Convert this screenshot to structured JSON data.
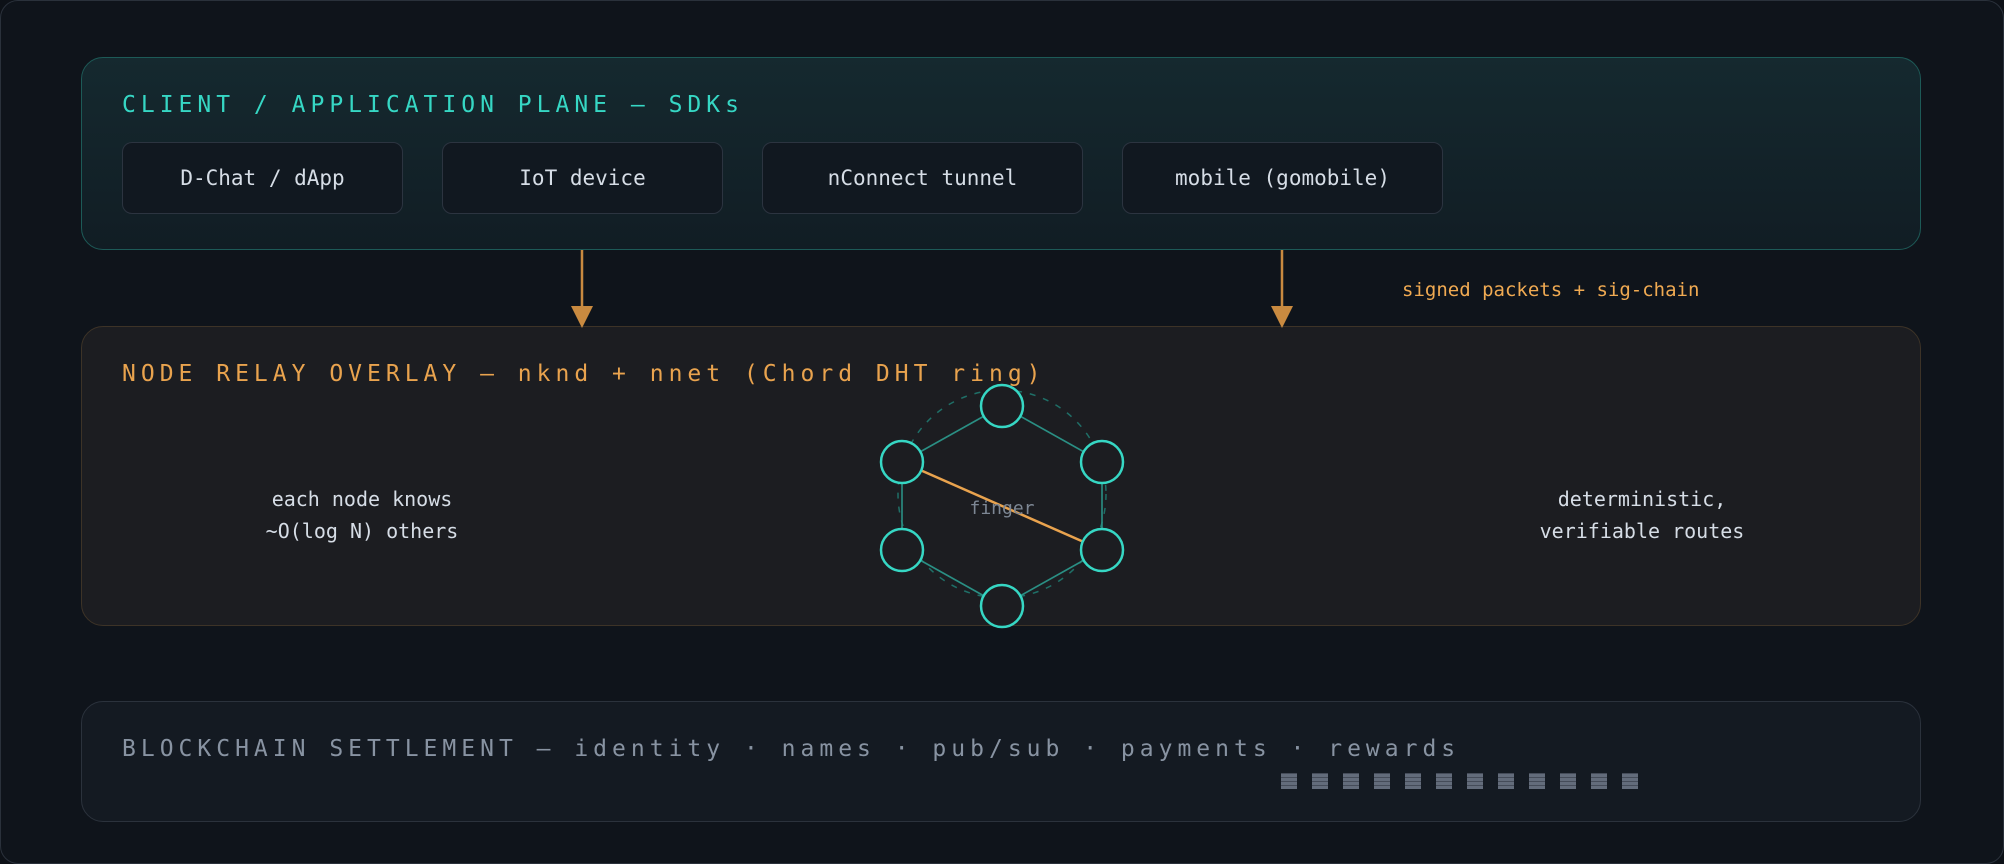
{
  "client_plane": {
    "title": "CLIENT / APPLICATION PLANE — SDKs",
    "items": [
      "D-Chat / dApp",
      "IoT device",
      "nConnect tunnel",
      "mobile (gomobile)"
    ]
  },
  "arrows": {
    "label": "signed packets + sig-chain"
  },
  "relay_overlay": {
    "title": "NODE RELAY OVERLAY — nknd + nnet (Chord DHT ring)",
    "left_note": [
      "each node knows",
      "~O(log N) others"
    ],
    "right_note": [
      "deterministic,",
      "verifiable routes"
    ],
    "ring": {
      "node_count": 6,
      "finger_label": "finger"
    }
  },
  "settlement": {
    "title": "BLOCKCHAIN SETTLEMENT — identity · names · pub/sub · payments · rewards",
    "block_count": 12
  },
  "colors": {
    "teal": "#36d7c4",
    "orange": "#e9a34e",
    "gray": "#8893a2"
  }
}
